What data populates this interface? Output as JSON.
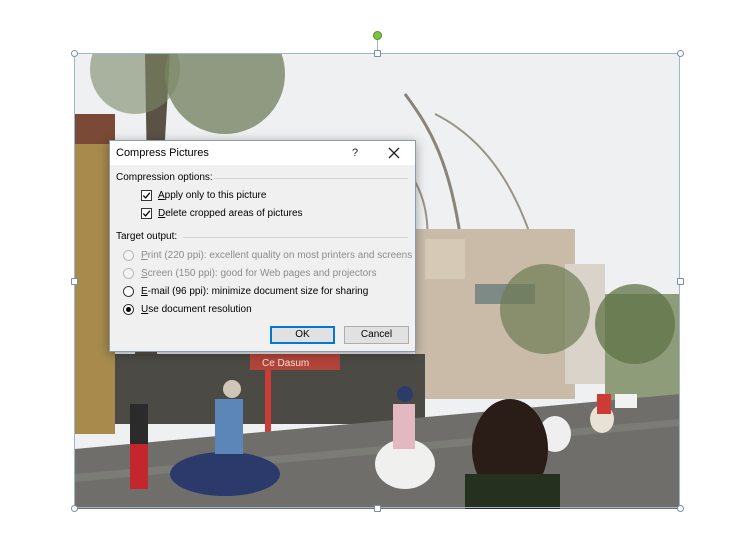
{
  "dialog": {
    "title": "Compress Pictures",
    "help_label": "?",
    "close_icon": "close-icon",
    "compression_options": {
      "label": "Compression options:",
      "items": [
        {
          "label": "Apply only to this picture",
          "underline": "A",
          "rest": "pply only to this picture",
          "checked": true
        },
        {
          "label": "Delete cropped areas of pictures",
          "underline": "D",
          "rest": "elete cropped areas of pictures",
          "checked": true
        }
      ]
    },
    "target_output": {
      "label": "Target output:",
      "items": [
        {
          "label": "Print (220 ppi): excellent quality on most printers and screens",
          "underline": "P",
          "rest": "rint (220 ppi): excellent quality on most printers and screens",
          "selected": false,
          "enabled": false
        },
        {
          "label": "Screen (150 ppi): good for Web pages and projectors",
          "underline": "S",
          "rest": "creen (150 ppi): good for Web pages and projectors",
          "selected": false,
          "enabled": false
        },
        {
          "label": "E-mail (96 ppi): minimize document size for sharing",
          "underline": "E",
          "rest": "-mail (96 ppi): minimize document size for sharing",
          "selected": false,
          "enabled": true
        },
        {
          "label": "Use document resolution",
          "underline": "U",
          "rest": "se document resolution",
          "selected": true,
          "enabled": true
        }
      ]
    },
    "ok_label": "OK",
    "cancel_label": "Cancel"
  },
  "picture": {
    "subject": "street-scene-photo",
    "shop_sign": "Ce Dasum"
  },
  "colors": {
    "selection_border": "#9fb5cc",
    "rotation_handle": "#7ec443",
    "default_button_border": "#0078d7"
  }
}
